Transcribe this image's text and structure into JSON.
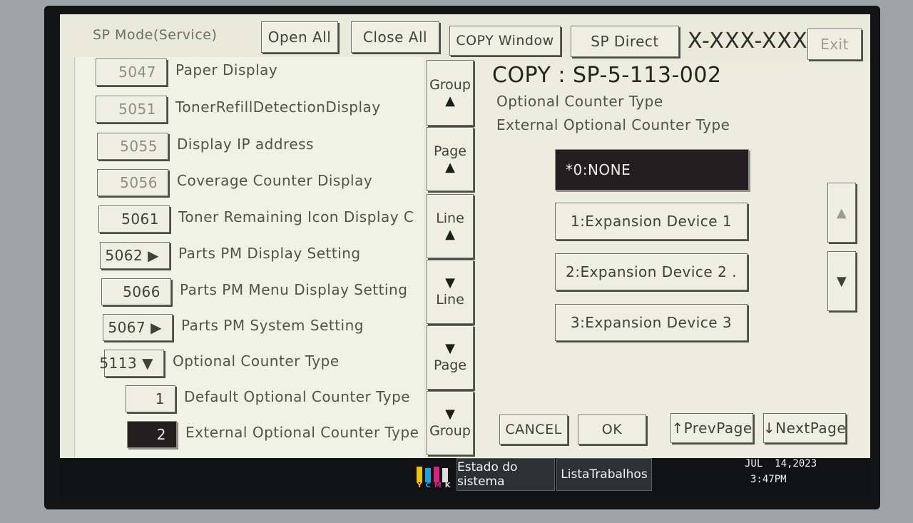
{
  "header": {
    "mode_title": "SP Mode(Service)",
    "open_all": "Open All",
    "close_all": "Close All",
    "copy_window": "COPY Window",
    "sp_direct": "SP Direct",
    "serial": "X-XXX-XXX",
    "exit": "Exit"
  },
  "sp_list": [
    {
      "code": "5047",
      "label": "Paper Display",
      "dim": true
    },
    {
      "code": "5051",
      "label": "TonerRefillDetectionDisplay",
      "dim": true
    },
    {
      "code": "5055",
      "label": "Display IP address",
      "dim": true
    },
    {
      "code": "5056",
      "label": "Coverage Counter Display",
      "dim": true
    },
    {
      "code": "5061",
      "label": "Toner Remaining Icon Display C"
    },
    {
      "code": "5062 ▶",
      "label": "Parts PM Display Setting"
    },
    {
      "code": "5066",
      "label": "Parts PM Menu Display Setting"
    },
    {
      "code": "5067 ▶",
      "label": "Parts PM System Setting"
    },
    {
      "code": "5113 ▼",
      "label": "Optional Counter Type"
    },
    {
      "code": "1",
      "label": "Default Optional Counter Type"
    },
    {
      "code": "2",
      "label": "External Optional Counter Type",
      "selected": true
    }
  ],
  "nav": {
    "group_up": "Group",
    "page_up": "Page",
    "line_up": "Line",
    "line_down": "Line",
    "page_down": "Page",
    "group_down": "Group",
    "up_arrow": "▲",
    "down_arrow": "▼"
  },
  "detail": {
    "sp_number": "COPY : SP-5-113-002",
    "line1": "Optional Counter Type",
    "line2": "External Optional Counter Type",
    "options": [
      {
        "label": "*0:NONE",
        "selected": true
      },
      {
        "label": "1:Expansion Device 1"
      },
      {
        "label": "2:Expansion Device 2 ."
      },
      {
        "label": "3:Expansion Device 3"
      }
    ],
    "scroll_up": "▲",
    "scroll_down": "▼",
    "cancel": "CANCEL",
    "ok": "OK",
    "prev_page": "↑PrevPage",
    "next_page": "↓NextPage"
  },
  "statusbar": {
    "toner_letters": [
      "Y",
      "C",
      "M",
      "K"
    ],
    "estado": "Estado do sistema",
    "lista": "ListaTrabalhos",
    "date": "JUL  14,2023",
    "time": "3:47PM"
  },
  "colors": {
    "screen_bg": "#e9ead9",
    "selected_bg": "#231f20",
    "toner_y": "#f2c400",
    "toner_c": "#1ea1e0",
    "toner_m": "#e02080",
    "toner_k": "#202020"
  }
}
